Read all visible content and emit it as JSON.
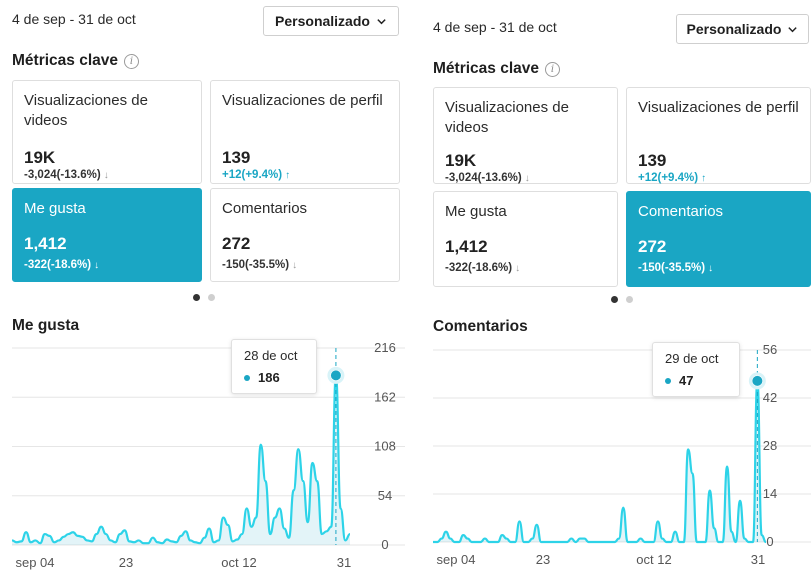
{
  "accent_color": "#1aa6c4",
  "left": {
    "date_range": "4 de sep - 31 de oct",
    "custom_button": "Personalizado",
    "metrics_title": "Métricas clave",
    "cards": [
      {
        "label": "Visualizaciones de videos",
        "value": "19K",
        "delta": "-3,024(-13.6%)",
        "arrow": "↓",
        "trend": "down"
      },
      {
        "label": "Visualizaciones de perfil",
        "value": "139",
        "delta": "+12(+9.4%)",
        "arrow": "↑",
        "trend": "up"
      },
      {
        "label": "Me gusta",
        "value": "1,412",
        "delta": "-322(-18.6%)",
        "arrow": "↓",
        "trend": "down",
        "selected": true
      },
      {
        "label": "Comentarios",
        "value": "272",
        "delta": "-150(-35.5%)",
        "arrow": "↓",
        "trend": "down"
      }
    ],
    "chart_title": "Me gusta",
    "tooltip": {
      "date": "28 de oct",
      "value": "186"
    }
  },
  "right": {
    "date_range": "4 de sep - 31 de oct",
    "custom_button": "Personalizado",
    "metrics_title": "Métricas clave",
    "cards": [
      {
        "label": "Visualizaciones de videos",
        "value": "19K",
        "delta": "-3,024(-13.6%)",
        "arrow": "↓",
        "trend": "down"
      },
      {
        "label": "Visualizaciones de perfil",
        "value": "139",
        "delta": "+12(+9.4%)",
        "arrow": "↑",
        "trend": "up"
      },
      {
        "label": "Me gusta",
        "value": "1,412",
        "delta": "-322(-18.6%)",
        "arrow": "↓",
        "trend": "down"
      },
      {
        "label": "Comentarios",
        "value": "272",
        "delta": "-150(-35.5%)",
        "arrow": "↓",
        "trend": "down",
        "selected": true
      }
    ],
    "chart_title": "Comentarios",
    "tooltip": {
      "date": "29 de oct",
      "value": "47"
    }
  },
  "chart_data": [
    {
      "type": "area",
      "title": "Me gusta",
      "x_tick_labels": [
        "sep 04",
        "23",
        "oct 12",
        "31"
      ],
      "y_ticks": [
        0,
        54,
        108,
        162,
        216
      ],
      "ylim": [
        0,
        216
      ],
      "grid": true,
      "series": [
        {
          "values": [
            5,
            3,
            4,
            14,
            3,
            5,
            2,
            12,
            10,
            3,
            5,
            9,
            12,
            14,
            10,
            9,
            5,
            4,
            12,
            20,
            12,
            5,
            3,
            12,
            16,
            4,
            3,
            5,
            2,
            2,
            8,
            3,
            2,
            6,
            4,
            3,
            10,
            15,
            5,
            3,
            2,
            8,
            18,
            3,
            5,
            30,
            22,
            4,
            6,
            12,
            40,
            20,
            30,
            110,
            70,
            12,
            30,
            40,
            18,
            8,
            60,
            105,
            70,
            25,
            90,
            70,
            12,
            15,
            20,
            186,
            40,
            5,
            12
          ],
          "highlight": {
            "date": "28 de oct",
            "value": 186
          }
        }
      ]
    },
    {
      "type": "area",
      "title": "Comentarios",
      "x_tick_labels": [
        "sep 04",
        "23",
        "oct 12",
        "31"
      ],
      "y_ticks": [
        0,
        14,
        28,
        42,
        56
      ],
      "ylim": [
        0,
        56
      ],
      "grid": true,
      "series": [
        {
          "values": [
            0,
            0,
            1,
            3,
            1,
            0,
            0,
            2,
            1,
            0,
            0,
            0,
            1,
            0,
            0,
            0,
            2,
            1,
            0,
            0,
            6,
            0,
            0,
            1,
            5,
            0,
            0,
            0,
            0,
            0,
            0,
            0,
            1,
            0,
            1,
            1,
            0,
            0,
            0,
            0,
            0,
            0,
            0,
            1,
            10,
            0,
            0,
            0,
            1,
            0,
            0,
            0,
            6,
            1,
            0,
            0,
            3,
            0,
            0,
            27,
            20,
            0,
            0,
            0,
            15,
            4,
            0,
            0,
            22,
            3,
            0,
            12,
            1,
            0,
            0,
            47,
            2,
            0
          ],
          "highlight": {
            "date": "29 de oct",
            "value": 47
          }
        }
      ]
    }
  ]
}
